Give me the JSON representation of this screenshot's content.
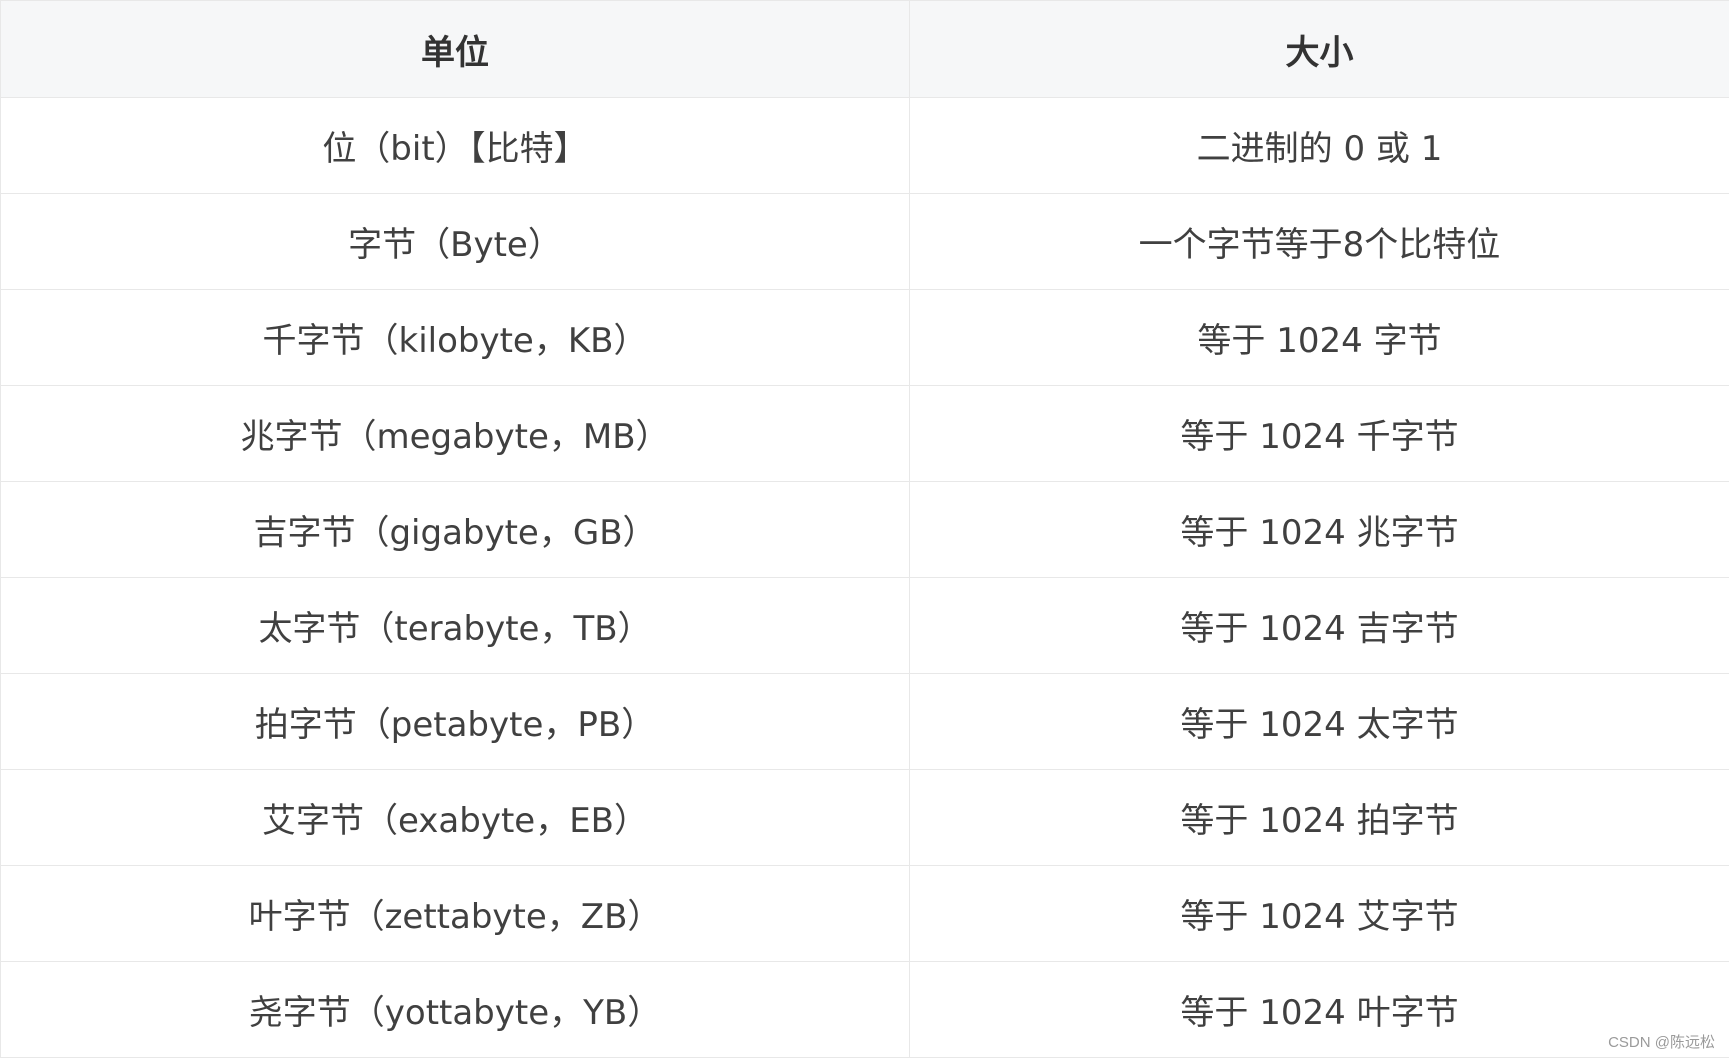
{
  "table": {
    "headers": [
      "单位",
      "大小"
    ],
    "rows": [
      [
        "位（bit）【比特】",
        "二进制的 0 或 1"
      ],
      [
        "字节（Byte）",
        "一个字节等于8个比特位"
      ],
      [
        "千字节（kilobyte，KB）",
        "等于 1024 字节"
      ],
      [
        "兆字节（megabyte，MB）",
        "等于 1024 千字节"
      ],
      [
        "吉字节（gigabyte，GB）",
        "等于 1024 兆字节"
      ],
      [
        "太字节（terabyte，TB）",
        "等于 1024 吉字节"
      ],
      [
        "拍字节（petabyte，PB）",
        "等于 1024 太字节"
      ],
      [
        "艾字节（exabyte，EB）",
        "等于 1024 拍字节"
      ],
      [
        "叶字节（zettabyte，ZB）",
        "等于 1024 艾字节"
      ],
      [
        "尧字节（yottabyte，YB）",
        "等于 1024 叶字节"
      ]
    ]
  },
  "watermark": "CSDN @陈远松",
  "colors": {
    "header_background": "#f6f7f8",
    "border": "#e8e8e8",
    "text": "#404040",
    "watermark": "#9a9a9a"
  }
}
